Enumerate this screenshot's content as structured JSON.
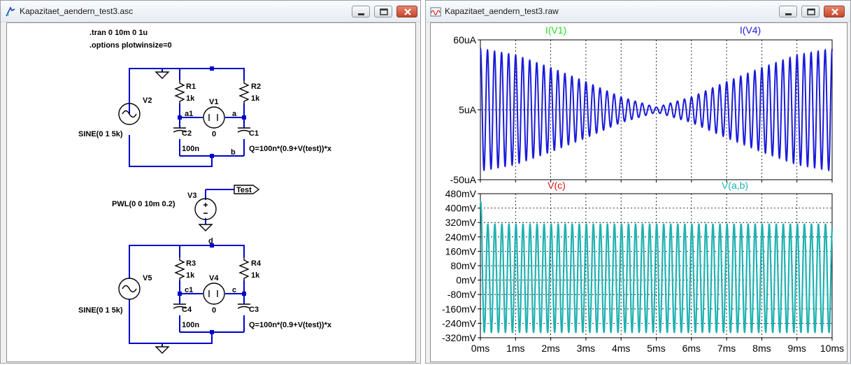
{
  "schematic_window": {
    "title": "Kapazitaet_aendern_test3.asc",
    "directives": [
      ".tran 0 10m 0 1u",
      ".options plotwinsize=0"
    ],
    "components": {
      "V2": {
        "name": "V2",
        "value": "SINE(0 1 5k)"
      },
      "R1": {
        "name": "R1",
        "value": "1k"
      },
      "R2": {
        "name": "R2",
        "value": "1k"
      },
      "V1": {
        "name": "V1",
        "value": "0"
      },
      "C2": {
        "name": "C2",
        "value": "100n"
      },
      "C1": {
        "name": "C1",
        "value": "Q=100n*(0.9+V(test))*x"
      },
      "V3": {
        "name": "V3",
        "value": "PWL(0 0 10m 0.2)"
      },
      "V5": {
        "name": "V5",
        "value": "SINE(0 1 5k)"
      },
      "R3": {
        "name": "R3",
        "value": "1k"
      },
      "R4": {
        "name": "R4",
        "value": "1k"
      },
      "V4": {
        "name": "V4",
        "value": "0"
      },
      "C4": {
        "name": "C4",
        "value": "100n"
      },
      "C3": {
        "name": "C3",
        "value": "Q=100n*(0.9+V(test))*x"
      }
    },
    "nets": {
      "a1": "a1",
      "a": "a",
      "b": "b",
      "test": "Test",
      "d": "d",
      "c1": "c1",
      "c": "c"
    }
  },
  "waveform_window": {
    "title": "Kapazitaet_aendern_test3.raw"
  },
  "colors": {
    "wire": "#0000cc",
    "component": "#000000",
    "junction": "#0000cc",
    "trace_top": "#1a1adc",
    "trace_bottom": "#1fb2b2",
    "label_I_V1": "#22dd22",
    "label_V_c": "#dd1111",
    "grid": "#000000",
    "close_button": "#c7432a"
  },
  "chart_data": [
    {
      "type": "line",
      "xlabel": "",
      "ylabel": "",
      "x_ticks": [
        "0ms",
        "1ms",
        "2ms",
        "3ms",
        "4ms",
        "5ms",
        "6ms",
        "7ms",
        "8ms",
        "9ms",
        "10ms"
      ],
      "xlim": [
        0,
        10
      ],
      "y_ticks": [
        "60uA",
        "5uA",
        "-50uA"
      ],
      "ylim": [
        -50,
        60
      ],
      "legend": [
        "I(V1)",
        "I(V4)"
      ],
      "series": [
        {
          "name": "I(V1)",
          "color": "#22dd22",
          "note_values": "trace hidden behind I(V4)"
        },
        {
          "name": "I(V4)",
          "color": "#1a1adc",
          "frequency_khz": 5,
          "offset_ua": 5,
          "envelope_x_ms": [
            0,
            1,
            2,
            3,
            4,
            5,
            6,
            7,
            8,
            9,
            10
          ],
          "envelope_amplitude_ua": [
            48,
            43,
            33,
            22,
            10,
            2,
            10,
            22,
            33,
            43,
            48
          ]
        }
      ]
    },
    {
      "type": "line",
      "xlabel": "",
      "ylabel": "",
      "x_ticks": [
        "0ms",
        "1ms",
        "2ms",
        "3ms",
        "4ms",
        "5ms",
        "6ms",
        "7ms",
        "8ms",
        "9ms",
        "10ms"
      ],
      "xlim": [
        0,
        10
      ],
      "y_ticks": [
        "480mV",
        "400mV",
        "320mV",
        "240mV",
        "160mV",
        "80mV",
        "0mV",
        "-80mV",
        "-160mV",
        "-240mV",
        "-320mV"
      ],
      "ylim": [
        -320,
        480
      ],
      "legend": [
        "V(c)",
        "V(a,b)"
      ],
      "series": [
        {
          "name": "V(c)",
          "color": "#dd1111",
          "note_values": "trace hidden behind V(a,b)"
        },
        {
          "name": "V(a,b)",
          "color": "#1fb2b2",
          "frequency_khz": 5,
          "peak_mv": 310,
          "trough_mv": -290,
          "initial_peak_mv": 440,
          "initial_trough_mv": -275
        }
      ]
    }
  ]
}
